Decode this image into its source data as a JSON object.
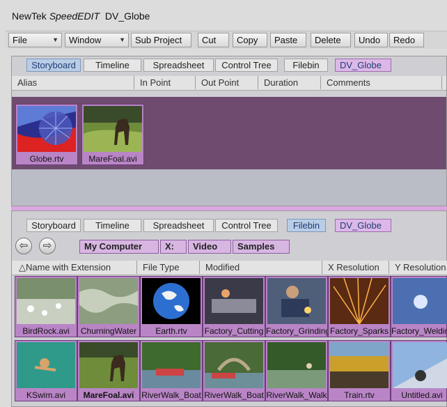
{
  "window": {
    "app": "NewTek",
    "app_italic": "SpeedEDIT",
    "project": "DV_Globe"
  },
  "toolbar": {
    "file": "File",
    "window": "Window",
    "subproject": "Sub Project",
    "cut": "Cut",
    "copy": "Copy",
    "paste": "Paste",
    "delete": "Delete",
    "undo": "Undo",
    "redo": "Redo"
  },
  "storyboard_panel": {
    "tabs": [
      "Storyboard",
      "Timeline",
      "Spreadsheet",
      "Control Tree",
      "Filebin"
    ],
    "active_tab": "Storyboard",
    "project_tab": "DV_Globe",
    "columns": [
      "Alias",
      "In Point",
      "Out Point",
      "Duration",
      "Comments"
    ],
    "clips": [
      {
        "label": "Globe.rtv",
        "thumb": "globe-thumbnail"
      },
      {
        "label": "MareFoal.avi",
        "thumb": "horse-thumbnail"
      }
    ]
  },
  "filebin_panel": {
    "tabs": [
      "Storyboard",
      "Timeline",
      "Spreadsheet",
      "Control Tree",
      "Filebin"
    ],
    "active_tab": "Filebin",
    "project_tab": "DV_Globe",
    "path": [
      "My Computer",
      "X:",
      "Video",
      "Samples"
    ],
    "columns": [
      "Name with Extension",
      "File Type",
      "Modified",
      "X Resolution",
      "Y Resolution"
    ],
    "files_row1": [
      "BirdRock.avi",
      "ChurningWater",
      "Earth.rtv",
      "Factory_Cutting",
      "Factory_Grinding",
      "Factory_Sparks",
      "Factory_Welding"
    ],
    "files_row2": [
      "KSwim.avi",
      "MareFoal.avi",
      "RiverWalk_Boat",
      "RiverWalk_Boat",
      "RiverWalk_Walk",
      "Train.rtv",
      "Untitled.avi"
    ]
  },
  "colors": {
    "clip_purple": "#b985c6",
    "storyboard_bg": "#6f4c6f",
    "active_tab": "#b9cde6"
  }
}
